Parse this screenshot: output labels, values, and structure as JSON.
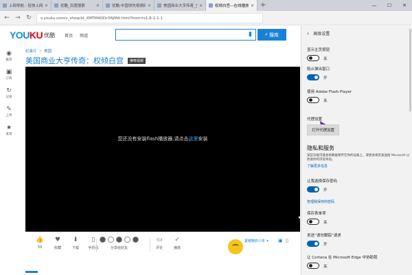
{
  "browser": {
    "tabs": [
      {
        "title": "上网导航 - 轻快上网 从这里",
        "active": false
      },
      {
        "title": "优酷_百度搜索",
        "active": false
      },
      {
        "title": "优酷-中国领先视频网站,提供",
        "active": false
      },
      {
        "title": "美国商业大亨传奇_全集 - 腾",
        "active": false
      },
      {
        "title": "权倾白宫—在线播放—",
        "active": true
      }
    ],
    "new_tab": "+",
    "window_controls": [
      "—",
      "☐",
      "✕"
    ],
    "address": "v.youku.com/v_show/id_XMTM4ODc5NjM4.html?from=s1.8-1-1.1"
  },
  "site": {
    "logo_you": "YOU",
    "logo_ku": "KU",
    "logo_cn": "优酷",
    "nav": [
      "首页",
      "频道"
    ],
    "search_placeholder": "",
    "search_button": "搜库"
  },
  "sidebar": [
    {
      "icon": "◉",
      "label": "推荐"
    },
    {
      "icon": "▣",
      "label": "订阅"
    },
    {
      "icon": "↻",
      "label": "记录"
    },
    {
      "icon": "✎",
      "label": "上传"
    },
    {
      "icon": "★",
      "label": "发现"
    }
  ],
  "video": {
    "breadcrumb": [
      "纪录片",
      "美国"
    ],
    "title": "美国商业大亨传奇：权倾白宫",
    "badge": "推荐视频",
    "flash_message_pre": "您还没有安装flash播放器,请点击",
    "flash_message_link": "这里",
    "flash_message_post": "安装"
  },
  "actions": [
    {
      "icon": "👍",
      "label": "59"
    },
    {
      "icon": "♥",
      "label": "收藏"
    },
    {
      "icon": "⬇",
      "label": "下载"
    },
    {
      "icon": "▯",
      "label": "手机看"
    }
  ],
  "share_label": "分享给好友",
  "comment_label": "评论",
  "play_label": "播放",
  "promo_text": "蒙眼鞋的少年 ✦",
  "settings": {
    "header": "高级设置",
    "show_home": {
      "label": "显示主页按钮",
      "state": "关",
      "on": false
    },
    "block_popups": {
      "label": "阻止弹出窗口",
      "state": "开",
      "on": true
    },
    "flash": {
      "label": "使用 Adobe Flash Player",
      "state": "关",
      "on": false
    },
    "proxy": {
      "label": "代理设置",
      "button": "打开代理设置"
    },
    "privacy": {
      "title": "隐私和服务",
      "desc": "某些功能可能会将数据保存在你的设备上，或者会将其发送给 Microsoft 以改进你的浏览体验。",
      "link": "了解更多信息"
    },
    "save_passwords": {
      "label": "让我选择保存密码",
      "state": "开",
      "on": true
    },
    "manage_passwords": "管理我保存的密码",
    "save_forms": {
      "label": "保存表单项",
      "state": "关",
      "on": false
    },
    "dnt": {
      "label": "发送“请勿跟踪”请求",
      "state": "开",
      "on": true
    },
    "cortana": {
      "label": "让 Cortana 在 Microsoft Edge 中协助我",
      "state": "关",
      "on": false
    }
  }
}
